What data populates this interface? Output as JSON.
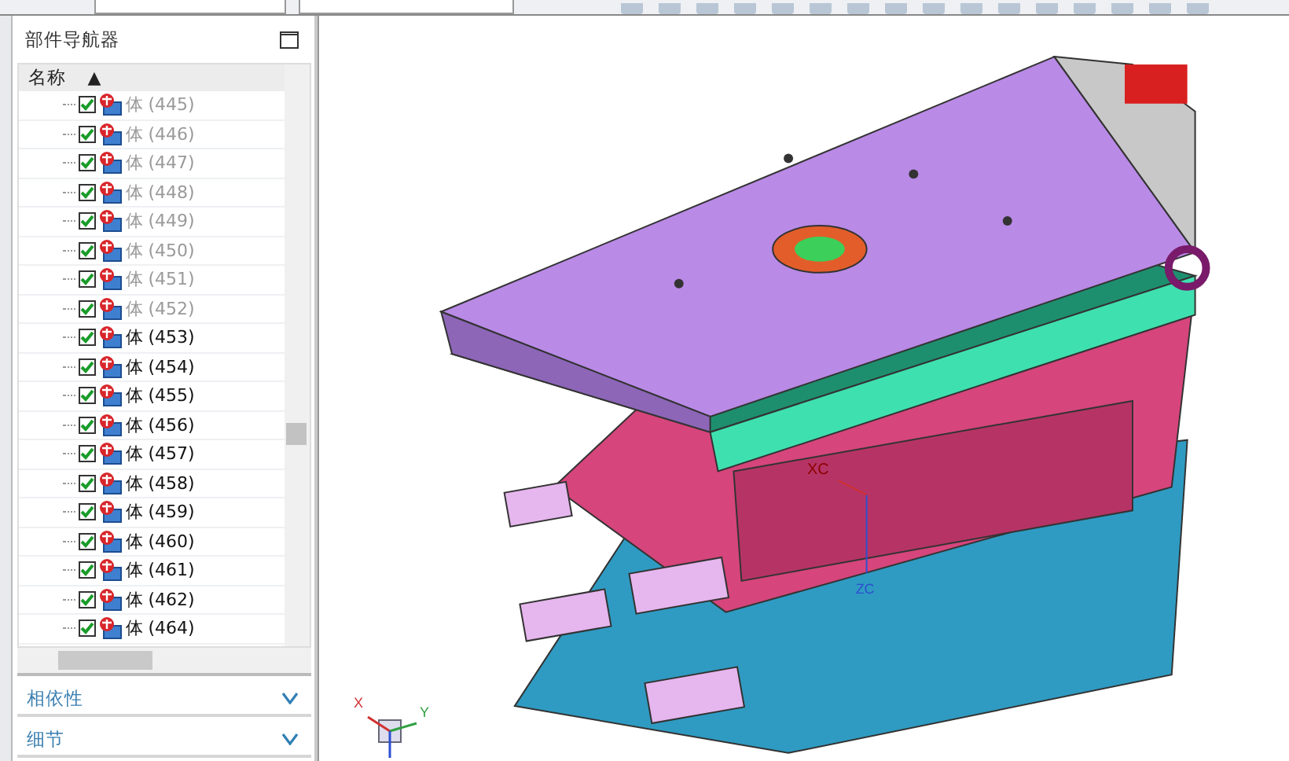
{
  "navigator": {
    "title": "部件导航器",
    "column": "名称",
    "sort_indicator": "▲",
    "rows": [
      {
        "label": "体 (445)",
        "checked": true,
        "greyed": true
      },
      {
        "label": "体 (446)",
        "checked": true,
        "greyed": true
      },
      {
        "label": "体 (447)",
        "checked": true,
        "greyed": true
      },
      {
        "label": "体 (448)",
        "checked": true,
        "greyed": true
      },
      {
        "label": "体 (449)",
        "checked": true,
        "greyed": true
      },
      {
        "label": "体 (450)",
        "checked": true,
        "greyed": true
      },
      {
        "label": "体 (451)",
        "checked": true,
        "greyed": true
      },
      {
        "label": "体 (452)",
        "checked": true,
        "greyed": true
      },
      {
        "label": "体 (453)",
        "checked": true,
        "greyed": false
      },
      {
        "label": "体 (454)",
        "checked": true,
        "greyed": false
      },
      {
        "label": "体 (455)",
        "checked": true,
        "greyed": false
      },
      {
        "label": "体 (456)",
        "checked": true,
        "greyed": false
      },
      {
        "label": "体 (457)",
        "checked": true,
        "greyed": false
      },
      {
        "label": "体 (458)",
        "checked": true,
        "greyed": false
      },
      {
        "label": "体 (459)",
        "checked": true,
        "greyed": false
      },
      {
        "label": "体 (460)",
        "checked": true,
        "greyed": false
      },
      {
        "label": "体 (461)",
        "checked": true,
        "greyed": false
      },
      {
        "label": "体 (462)",
        "checked": true,
        "greyed": false
      },
      {
        "label": "体 (464)",
        "checked": true,
        "greyed": false
      }
    ],
    "sections": [
      {
        "label": "相依性",
        "expanded": false
      },
      {
        "label": "细节",
        "expanded": false
      }
    ]
  },
  "viewport": {
    "model_axes": [
      "XC",
      "ZC"
    ],
    "triad_axes": [
      "X",
      "Y"
    ]
  }
}
